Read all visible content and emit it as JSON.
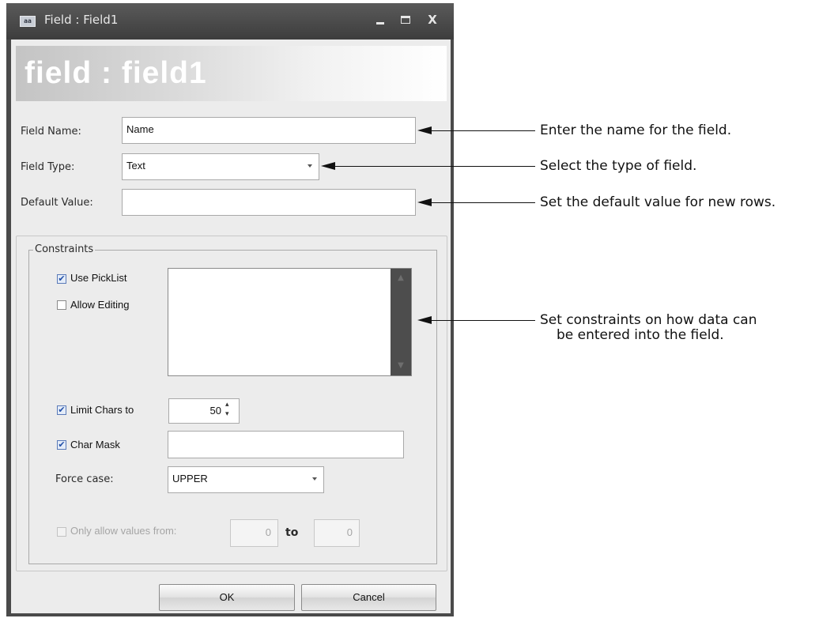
{
  "window": {
    "title": "Field : Field1",
    "app_icon_text": "aa",
    "close_glyph": "X"
  },
  "banner": {
    "text": "field : field1"
  },
  "form": {
    "field_name_label": "Field Name:",
    "field_name_value": "Name",
    "field_type_label": "Field Type:",
    "field_type_value": "Text",
    "default_value_label": "Default Value:",
    "default_value_value": ""
  },
  "constraints": {
    "group_title": "Constraints",
    "use_picklist": {
      "label": "Use PickList",
      "checked": true
    },
    "allow_editing": {
      "label": "Allow Editing",
      "checked": false
    },
    "picklist_items": [],
    "limit_chars": {
      "label": "Limit Chars to",
      "checked": true,
      "value": "50"
    },
    "char_mask": {
      "label": "Char Mask",
      "checked": true,
      "value": ""
    },
    "force_case": {
      "label": "Force case:",
      "value": "UPPER"
    },
    "only_allow": {
      "label": "Only allow values from:",
      "checked": false,
      "from": "0",
      "to_label": "to",
      "to": "0"
    }
  },
  "buttons": {
    "ok": "OK",
    "cancel": "Cancel"
  },
  "callouts": {
    "name": "Enter the name for the field.",
    "type": "Select the type of field.",
    "default": "Set the default value for new rows.",
    "constraints_line1": "Set constraints on how data can",
    "constraints_line2": "be entered into the field."
  },
  "colors": {
    "titlebar": "#4a4a4a",
    "dialog_bg": "#ececec",
    "check_accent": "#2350a8"
  }
}
